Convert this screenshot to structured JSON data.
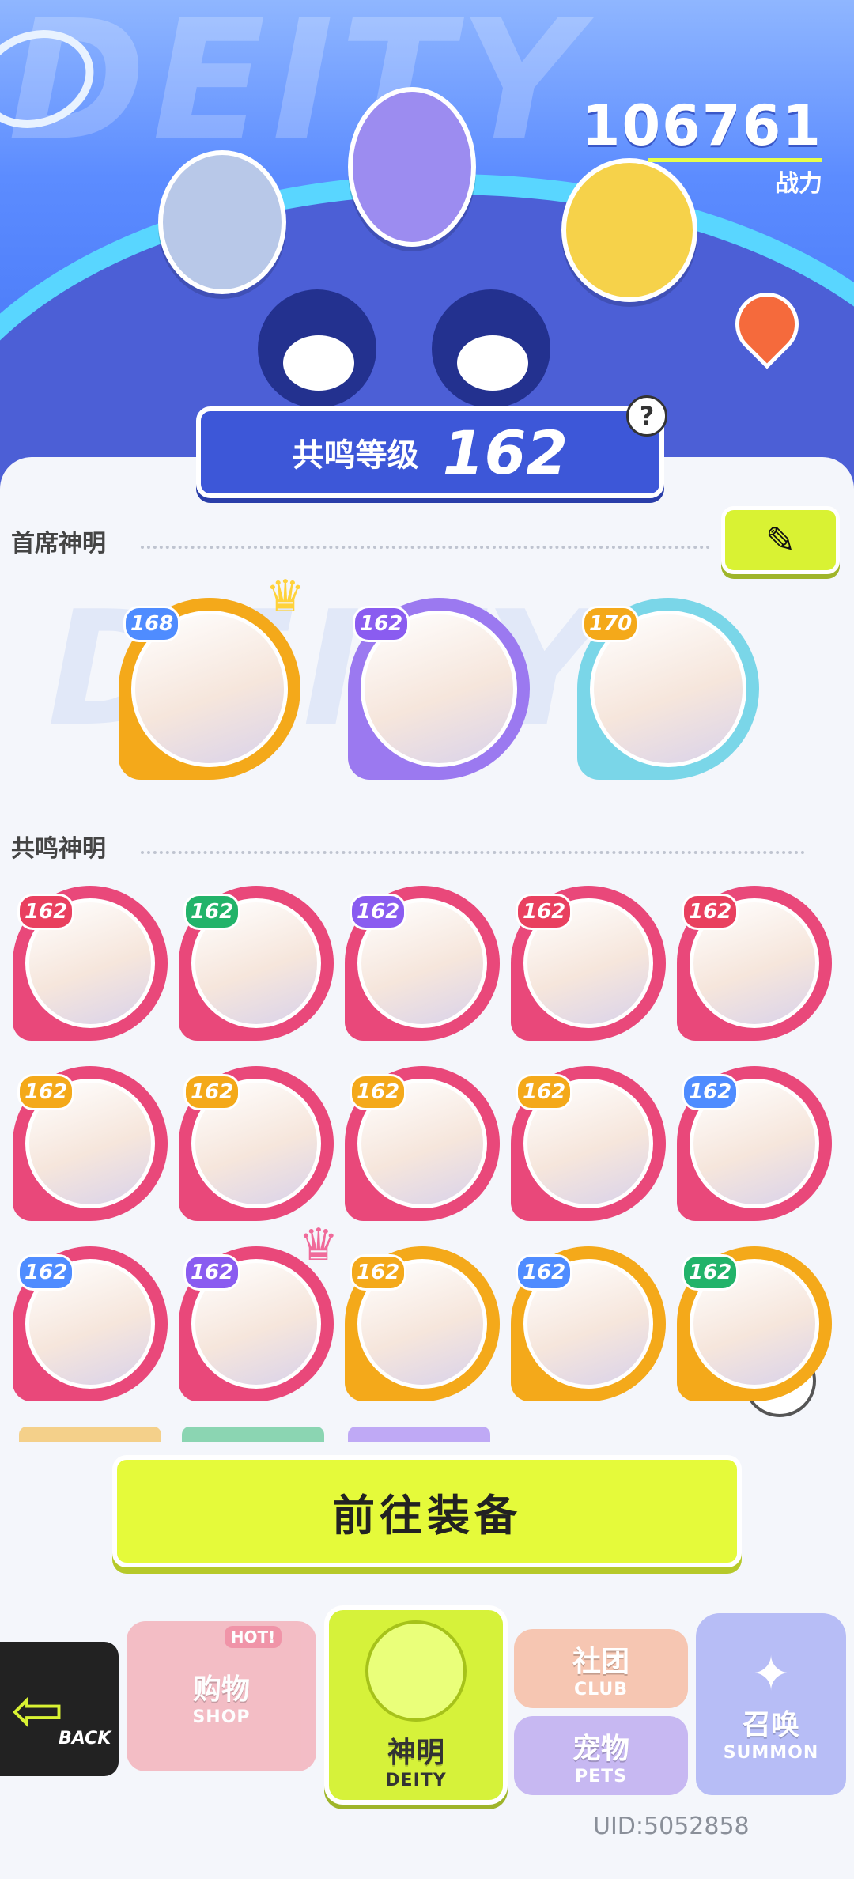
{
  "header": {
    "power_value": "106761",
    "power_label": "战力",
    "resonance_label": "共鸣等级",
    "resonance_level": "162",
    "help_symbol": "?"
  },
  "featured": {
    "title": "首席神明",
    "items": [
      {
        "level": "168",
        "badge_color": "#4f8cff",
        "frame": "#f4a91a"
      },
      {
        "level": "162",
        "badge_color": "#8a5cf0",
        "frame": "#9b79f0"
      },
      {
        "level": "170",
        "badge_color": "#f4a91a",
        "frame": "#7ad6e8"
      }
    ]
  },
  "resonance": {
    "title": "共鸣神明",
    "rows": [
      [
        {
          "level": "162",
          "badge_color": "#e9405f",
          "frame": "#e9487a"
        },
        {
          "level": "162",
          "badge_color": "#22b36a",
          "frame": "#e9487a"
        },
        {
          "level": "162",
          "badge_color": "#8a5cf0",
          "frame": "#e9487a"
        },
        {
          "level": "162",
          "badge_color": "#e9405f",
          "frame": "#e9487a"
        },
        {
          "level": "162",
          "badge_color": "#e9405f",
          "frame": "#e9487a"
        }
      ],
      [
        {
          "level": "162",
          "badge_color": "#f4a91a",
          "frame": "#e9487a"
        },
        {
          "level": "162",
          "badge_color": "#f4a91a",
          "frame": "#e9487a"
        },
        {
          "level": "162",
          "badge_color": "#f4a91a",
          "frame": "#e9487a"
        },
        {
          "level": "162",
          "badge_color": "#f4a91a",
          "frame": "#e9487a"
        },
        {
          "level": "162",
          "badge_color": "#4f8cff",
          "frame": "#e9487a"
        }
      ],
      [
        {
          "level": "162",
          "badge_color": "#4f8cff",
          "frame": "#e9487a"
        },
        {
          "level": "162",
          "badge_color": "#8a5cf0",
          "frame": "#e9487a"
        },
        {
          "level": "162",
          "badge_color": "#f4a91a",
          "frame": "#f4a91a"
        },
        {
          "level": "162",
          "badge_color": "#4f8cff",
          "frame": "#f4a91a"
        },
        {
          "level": "162",
          "badge_color": "#22b36a",
          "frame": "#f4a91a"
        }
      ]
    ]
  },
  "cta_label": "前往装备",
  "nav": {
    "back": "BACK",
    "shop_cn": "购物",
    "shop_en": "SHOP",
    "shop_hot": "HOT!",
    "deity_cn": "神明",
    "deity_en": "DEITY",
    "club_cn": "社团",
    "club_en": "CLUB",
    "pets_cn": "宠物",
    "pets_en": "PETS",
    "summon_cn": "召唤",
    "summon_en": "SUMMON"
  },
  "uid": "UID:5052858",
  "icons": [
    "location-pin-icon",
    "edit-pencil-icon",
    "crown-icon",
    "filter-icon",
    "back-arrow-icon",
    "help-icon"
  ]
}
